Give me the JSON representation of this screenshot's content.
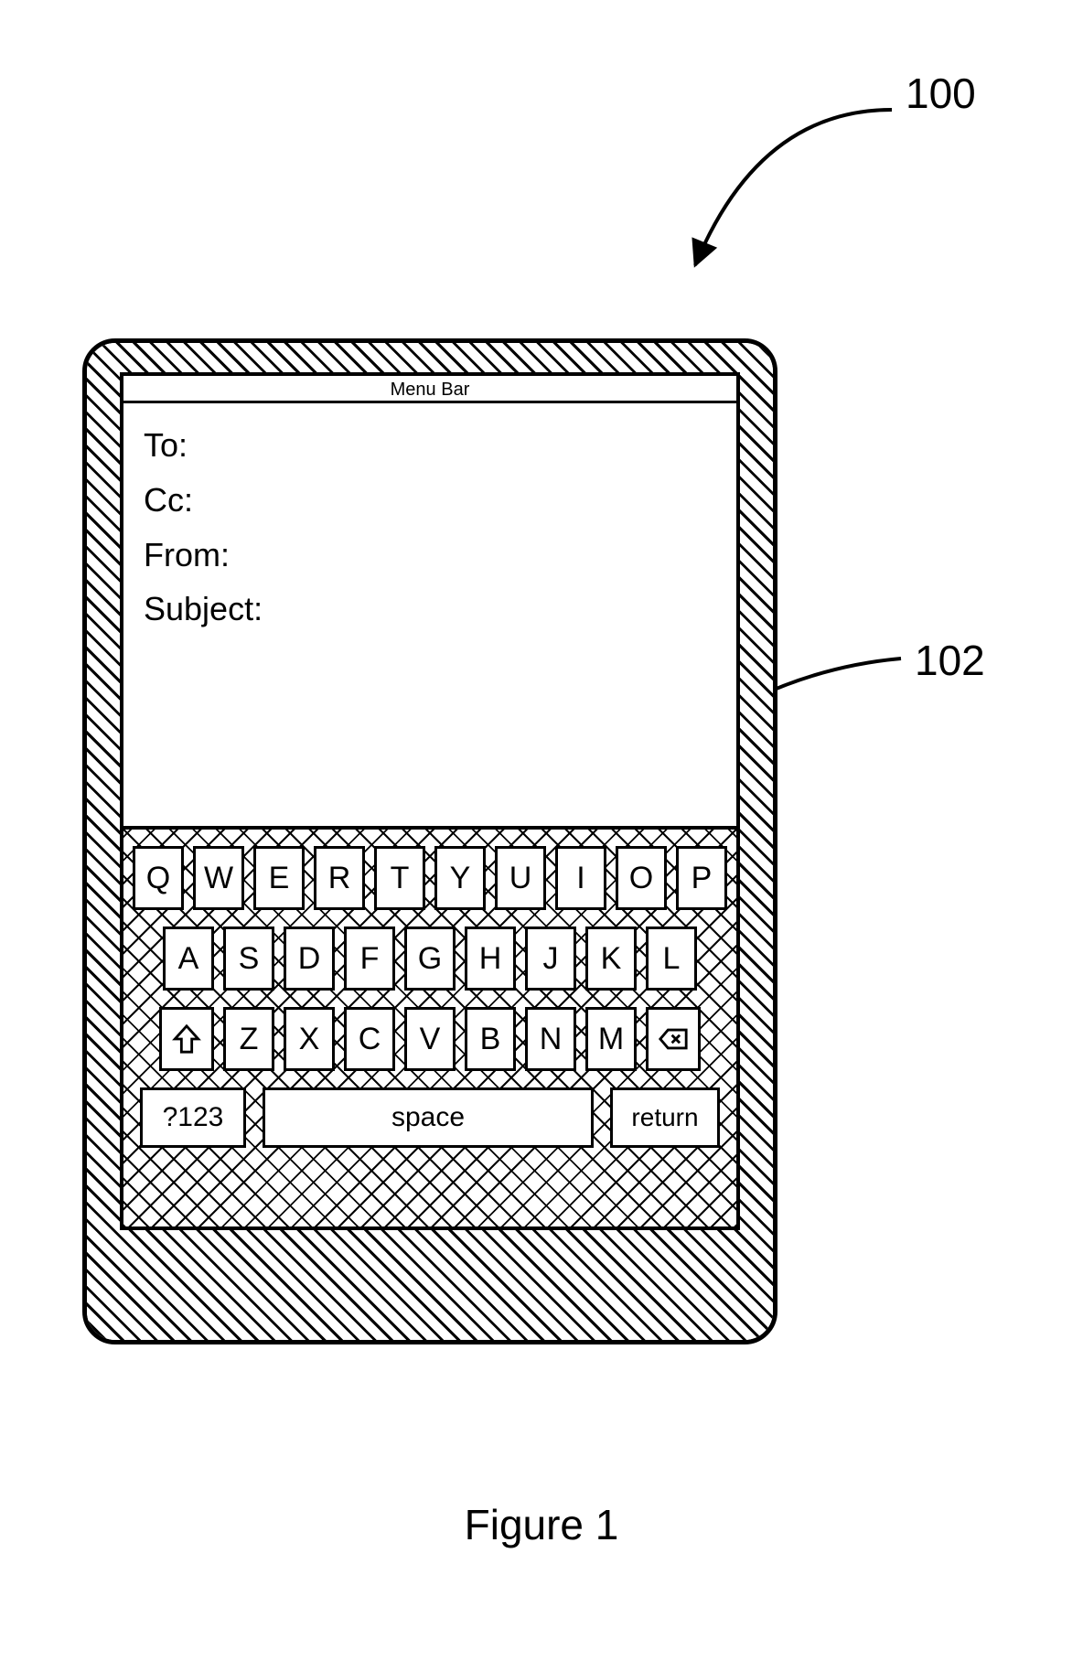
{
  "figure": {
    "caption": "Figure 1",
    "refs": {
      "device": "100",
      "keyboard": "102"
    }
  },
  "menu_bar": {
    "label": "Menu Bar"
  },
  "mail": {
    "fields": {
      "to": "To:",
      "cc": "Cc:",
      "from": "From:",
      "subject": "Subject:"
    }
  },
  "keyboard": {
    "row1": [
      "Q",
      "W",
      "E",
      "R",
      "T",
      "Y",
      "U",
      "I",
      "O",
      "P"
    ],
    "row2": [
      "A",
      "S",
      "D",
      "F",
      "G",
      "H",
      "J",
      "K",
      "L"
    ],
    "row3": [
      "Z",
      "X",
      "C",
      "V",
      "B",
      "N",
      "M"
    ],
    "shift_icon": "shift",
    "backspace_icon": "backspace",
    "numkey": "?123",
    "space": "space",
    "return": "return"
  }
}
